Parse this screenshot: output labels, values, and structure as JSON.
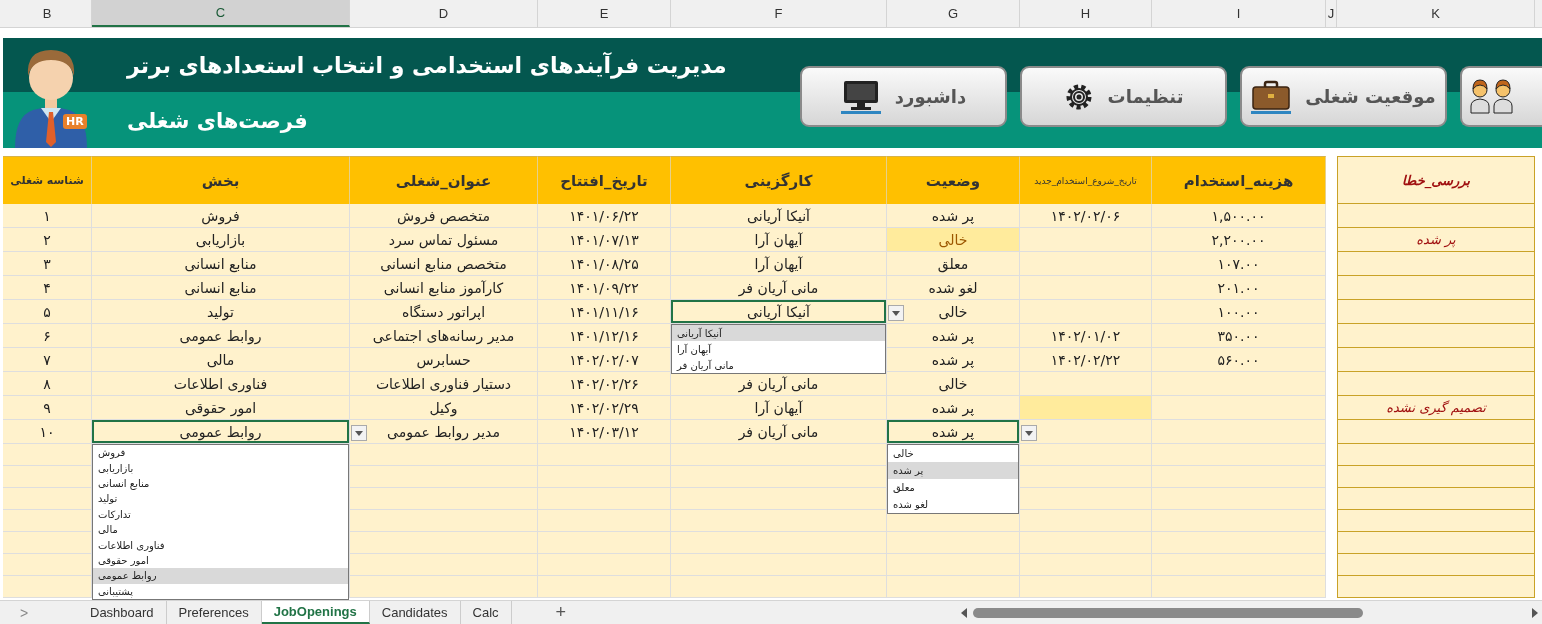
{
  "column_letters": [
    {
      "label": "K",
      "selected": false
    },
    {
      "label": "J",
      "selected": false
    },
    {
      "label": "I",
      "selected": false
    },
    {
      "label": "H",
      "selected": false
    },
    {
      "label": "G",
      "selected": false
    },
    {
      "label": "F",
      "selected": false
    },
    {
      "label": "E",
      "selected": false
    },
    {
      "label": "D",
      "selected": false
    },
    {
      "label": "C",
      "selected": true
    },
    {
      "label": "B",
      "selected": false
    }
  ],
  "banner": {
    "buttons": [
      {
        "kind": "icon-only"
      },
      {
        "kind": "labeled",
        "label": "موقعیت شغلی"
      },
      {
        "kind": "labeled",
        "label": "تنظیمات"
      },
      {
        "kind": "labeled",
        "label": "داشبورد"
      }
    ],
    "title": "مدیریت فرآیندهای استخدامی و انتخاب استعدادهای برتر",
    "subtitle": "فرصت‌های شغلی",
    "avatar_badge": "HR"
  },
  "table": {
    "error_column": "بررسی_خطا",
    "columns": [
      "هزینه_استخدام",
      "تاریخ_شروع_استخدام_جدید",
      "وضعیت",
      "کارگزینی",
      "تاریخ_افتتاح",
      "عنوان_شغلی",
      "بخش",
      "شناسه شغلی"
    ],
    "rows": [
      {
        "cost": "۱,۵۰۰.۰۰",
        "hire_date": "۱۴۰۲/۰۲/۰۶",
        "hire_date_flagged": false,
        "status": "پر شده",
        "status_flagged": false,
        "recruiter": "آنیکا آریانی",
        "open_date": "۱۴۰۱/۰۶/۲۲",
        "title": "متخصص فروش",
        "department": "فروش",
        "id": "۱"
      },
      {
        "error_check": "پر شده",
        "cost": "۲,۲۰۰.۰۰",
        "hire_date_flagged": false,
        "status": "خالی",
        "status_flagged": true,
        "recruiter": "آیهان آرا",
        "open_date": "۱۴۰۱/۰۷/۱۳",
        "title": "مسئول تماس سرد",
        "department": "بازاریابی",
        "id": "۲"
      },
      {
        "cost": "۱۰۷.۰۰",
        "hire_date_flagged": false,
        "status": "معلق",
        "status_flagged": false,
        "recruiter": "آیهان آرا",
        "open_date": "۱۴۰۱/۰۸/۲۵",
        "title": "متخصص منابع انسانی",
        "department": "منابع انسانی",
        "id": "۳"
      },
      {
        "cost": "۲۰۱.۰۰",
        "hire_date_flagged": false,
        "status": "لغو شده",
        "status_flagged": false,
        "recruiter": "مانی آریان فر",
        "open_date": "۱۴۰۱/۰۹/۲۲",
        "title": "کارآموز منابع انسانی",
        "department": "منابع انسانی",
        "id": "۴"
      },
      {
        "cost": "۱۰۰.۰۰",
        "hire_date_flagged": false,
        "status": "خالی",
        "status_flagged": false,
        "recruiter": "آنیکا آریانی",
        "recruiter_dropdown": [
          {
            "label": "آنیکا آریانی",
            "selected": true
          },
          {
            "label": "آیهان آرا",
            "selected": false
          },
          {
            "label": "مانی آریان فر",
            "selected": false
          }
        ],
        "open_date": "۱۴۰۱/۱۱/۱۶",
        "title": "اپراتور دستگاه",
        "department": "تولید",
        "id": "۵"
      },
      {
        "cost": "۳۵۰.۰۰",
        "hire_date": "۱۴۰۲/۰۱/۰۲",
        "hire_date_flagged": false,
        "status": "پر شده",
        "status_flagged": false,
        "open_date": "۱۴۰۱/۱۲/۱۶",
        "title": "مدیر رسانه‌های اجتماعی",
        "department": "روابط عمومی",
        "id": "۶"
      },
      {
        "cost": "۵۶۰.۰۰",
        "hire_date": "۱۴۰۲/۰۲/۲۲",
        "hire_date_flagged": false,
        "status": "پر شده",
        "status_flagged": false,
        "open_date": "۱۴۰۲/۰۲/۰۷",
        "title": "حسابرس",
        "department": "مالی",
        "id": "۷"
      },
      {
        "hire_date_flagged": false,
        "status": "خالی",
        "status_flagged": false,
        "recruiter": "مانی آریان فر",
        "open_date": "۱۴۰۲/۰۲/۲۶",
        "title": "دستیار فناوری اطلاعات",
        "department": "فناوری اطلاعات",
        "id": "۸"
      },
      {
        "error_check": "تصمیم گیری نشده",
        "hire_date_flagged": true,
        "status": "پر شده",
        "status_flagged": false,
        "recruiter": "آیهان آرا",
        "open_date": "۱۴۰۲/۰۲/۲۹",
        "title": "وکیل",
        "department": "امور حقوقی",
        "id": "۹"
      },
      {
        "hire_date_flagged": false,
        "status": "پر شده",
        "status_flagged": false,
        "status_dropdown": [
          {
            "label": "خالی",
            "selected": false
          },
          {
            "label": "پر شده",
            "selected": true
          },
          {
            "label": "معلق",
            "selected": false
          },
          {
            "label": "لغو شده",
            "selected": false
          }
        ],
        "recruiter": "مانی آریان فر",
        "open_date": "۱۴۰۲/۰۳/۱۲",
        "title": "مدیر روابط عمومی",
        "department": "روابط عمومی",
        "department_dropdown": [
          {
            "label": "فروش",
            "selected": false
          },
          {
            "label": "بازاریابی",
            "selected": false
          },
          {
            "label": "منابع انسانی",
            "selected": false
          },
          {
            "label": "تولید",
            "selected": false
          },
          {
            "label": "تدارکات",
            "selected": false
          },
          {
            "label": "مالی",
            "selected": false
          },
          {
            "label": "فناوری اطلاعات",
            "selected": false
          },
          {
            "label": "امور حقوقی",
            "selected": false
          },
          {
            "label": "روابط عمومی",
            "selected": true
          },
          {
            "label": "پشتیبانی",
            "selected": false
          }
        ],
        "id": "۱۰"
      }
    ]
  },
  "sheet_bar": {
    "add": "+",
    "tabs": [
      {
        "label": "Calc",
        "selected": false
      },
      {
        "label": "Candidates",
        "selected": false
      },
      {
        "label": "JobOpenings",
        "selected": true
      },
      {
        "label": "Preferences",
        "selected": false
      },
      {
        "label": "Dashboard",
        "selected": false
      }
    ],
    "nav": ">"
  }
}
